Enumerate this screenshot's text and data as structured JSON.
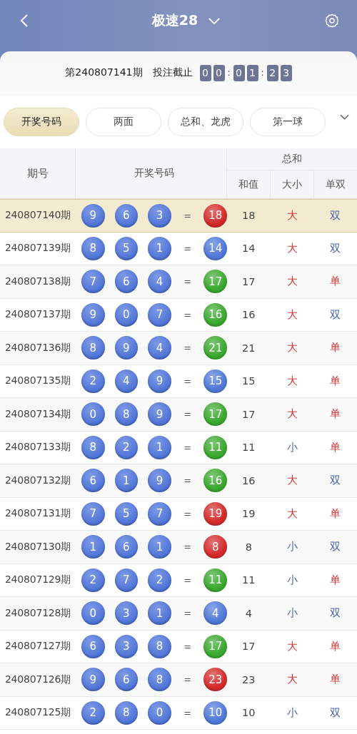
{
  "header": {
    "title": "极速28"
  },
  "draw_info": {
    "issue": "第240807141期",
    "label": "投注截止",
    "countdown": [
      {
        "kind": "digit",
        "text": "0"
      },
      {
        "kind": "digit",
        "text": "0"
      },
      {
        "kind": "sep",
        "text": ":"
      },
      {
        "kind": "digit",
        "text": "0"
      },
      {
        "kind": "digit",
        "text": "1"
      },
      {
        "kind": "sep",
        "text": ":"
      },
      {
        "kind": "digit",
        "text": "2"
      },
      {
        "kind": "digit",
        "text": "3"
      }
    ]
  },
  "tabs": [
    {
      "label": "开奖号码",
      "selected": true
    },
    {
      "label": "两面",
      "selected": false
    },
    {
      "label": "总和、龙虎",
      "selected": false
    },
    {
      "label": "第一球",
      "selected": false
    }
  ],
  "table": {
    "columns": {
      "issue": "期号",
      "numbers": "开奖号码",
      "total": "总和",
      "sum": "和值",
      "size": "大小",
      "parity": "单双"
    },
    "rows": [
      {
        "issue": "240807140期",
        "balls": [
          "9",
          "6",
          "3"
        ],
        "equals": "=",
        "sum_ball": {
          "text": "18",
          "color": "#d42a2a"
        },
        "sum": "18",
        "size": {
          "text": "大",
          "color": "#d03a3a"
        },
        "parity": {
          "text": "双",
          "color": "#4a63b0"
        },
        "selected": true
      },
      {
        "issue": "240807139期",
        "balls": [
          "8",
          "5",
          "1"
        ],
        "equals": "=",
        "sum_ball": {
          "text": "14",
          "color": "#4f78d8"
        },
        "sum": "14",
        "size": {
          "text": "大",
          "color": "#d03a3a"
        },
        "parity": {
          "text": "双",
          "color": "#4a63b0"
        },
        "selected": false
      },
      {
        "issue": "240807138期",
        "balls": [
          "7",
          "6",
          "4"
        ],
        "equals": "=",
        "sum_ball": {
          "text": "17",
          "color": "#3aa82e"
        },
        "sum": "17",
        "size": {
          "text": "大",
          "color": "#d03a3a"
        },
        "parity": {
          "text": "单",
          "color": "#d03a3a"
        },
        "selected": false
      },
      {
        "issue": "240807137期",
        "balls": [
          "9",
          "0",
          "7"
        ],
        "equals": "=",
        "sum_ball": {
          "text": "16",
          "color": "#3aa82e"
        },
        "sum": "16",
        "size": {
          "text": "大",
          "color": "#d03a3a"
        },
        "parity": {
          "text": "双",
          "color": "#4a63b0"
        },
        "selected": false
      },
      {
        "issue": "240807136期",
        "balls": [
          "8",
          "9",
          "4"
        ],
        "equals": "=",
        "sum_ball": {
          "text": "21",
          "color": "#3aa82e"
        },
        "sum": "21",
        "size": {
          "text": "大",
          "color": "#d03a3a"
        },
        "parity": {
          "text": "单",
          "color": "#d03a3a"
        },
        "selected": false
      },
      {
        "issue": "240807135期",
        "balls": [
          "2",
          "4",
          "9"
        ],
        "equals": "=",
        "sum_ball": {
          "text": "15",
          "color": "#4f78d8"
        },
        "sum": "15",
        "size": {
          "text": "大",
          "color": "#d03a3a"
        },
        "parity": {
          "text": "单",
          "color": "#d03a3a"
        },
        "selected": false
      },
      {
        "issue": "240807134期",
        "balls": [
          "0",
          "8",
          "9"
        ],
        "equals": "=",
        "sum_ball": {
          "text": "17",
          "color": "#3aa82e"
        },
        "sum": "17",
        "size": {
          "text": "大",
          "color": "#d03a3a"
        },
        "parity": {
          "text": "单",
          "color": "#d03a3a"
        },
        "selected": false
      },
      {
        "issue": "240807133期",
        "balls": [
          "8",
          "2",
          "1"
        ],
        "equals": "=",
        "sum_ball": {
          "text": "11",
          "color": "#3aa82e"
        },
        "sum": "11",
        "size": {
          "text": "小",
          "color": "#4a63b0"
        },
        "parity": {
          "text": "单",
          "color": "#d03a3a"
        },
        "selected": false
      },
      {
        "issue": "240807132期",
        "balls": [
          "6",
          "1",
          "9"
        ],
        "equals": "=",
        "sum_ball": {
          "text": "16",
          "color": "#3aa82e"
        },
        "sum": "16",
        "size": {
          "text": "大",
          "color": "#d03a3a"
        },
        "parity": {
          "text": "双",
          "color": "#4a63b0"
        },
        "selected": false
      },
      {
        "issue": "240807131期",
        "balls": [
          "7",
          "5",
          "7"
        ],
        "equals": "=",
        "sum_ball": {
          "text": "19",
          "color": "#d42a2a"
        },
        "sum": "19",
        "size": {
          "text": "大",
          "color": "#d03a3a"
        },
        "parity": {
          "text": "单",
          "color": "#d03a3a"
        },
        "selected": false
      },
      {
        "issue": "240807130期",
        "balls": [
          "1",
          "6",
          "1"
        ],
        "equals": "=",
        "sum_ball": {
          "text": "8",
          "color": "#d42a2a"
        },
        "sum": "8",
        "size": {
          "text": "小",
          "color": "#4a63b0"
        },
        "parity": {
          "text": "双",
          "color": "#4a63b0"
        },
        "selected": false
      },
      {
        "issue": "240807129期",
        "balls": [
          "2",
          "7",
          "2"
        ],
        "equals": "=",
        "sum_ball": {
          "text": "11",
          "color": "#3aa82e"
        },
        "sum": "11",
        "size": {
          "text": "小",
          "color": "#4a63b0"
        },
        "parity": {
          "text": "单",
          "color": "#d03a3a"
        },
        "selected": false
      },
      {
        "issue": "240807128期",
        "balls": [
          "0",
          "3",
          "1"
        ],
        "equals": "=",
        "sum_ball": {
          "text": "4",
          "color": "#4f78d8"
        },
        "sum": "4",
        "size": {
          "text": "小",
          "color": "#4a63b0"
        },
        "parity": {
          "text": "双",
          "color": "#4a63b0"
        },
        "selected": false
      },
      {
        "issue": "240807127期",
        "balls": [
          "6",
          "3",
          "8"
        ],
        "equals": "=",
        "sum_ball": {
          "text": "17",
          "color": "#3aa82e"
        },
        "sum": "17",
        "size": {
          "text": "大",
          "color": "#d03a3a"
        },
        "parity": {
          "text": "单",
          "color": "#d03a3a"
        },
        "selected": false
      },
      {
        "issue": "240807126期",
        "balls": [
          "9",
          "6",
          "8"
        ],
        "equals": "=",
        "sum_ball": {
          "text": "23",
          "color": "#d42a2a"
        },
        "sum": "23",
        "size": {
          "text": "大",
          "color": "#d03a3a"
        },
        "parity": {
          "text": "单",
          "color": "#d03a3a"
        },
        "selected": false
      },
      {
        "issue": "240807125期",
        "balls": [
          "2",
          "8",
          "0"
        ],
        "equals": "=",
        "sum_ball": {
          "text": "10",
          "color": "#4f78d8"
        },
        "sum": "10",
        "size": {
          "text": "小",
          "color": "#4a63b0"
        },
        "parity": {
          "text": "双",
          "color": "#4a63b0"
        },
        "selected": false
      }
    ]
  }
}
